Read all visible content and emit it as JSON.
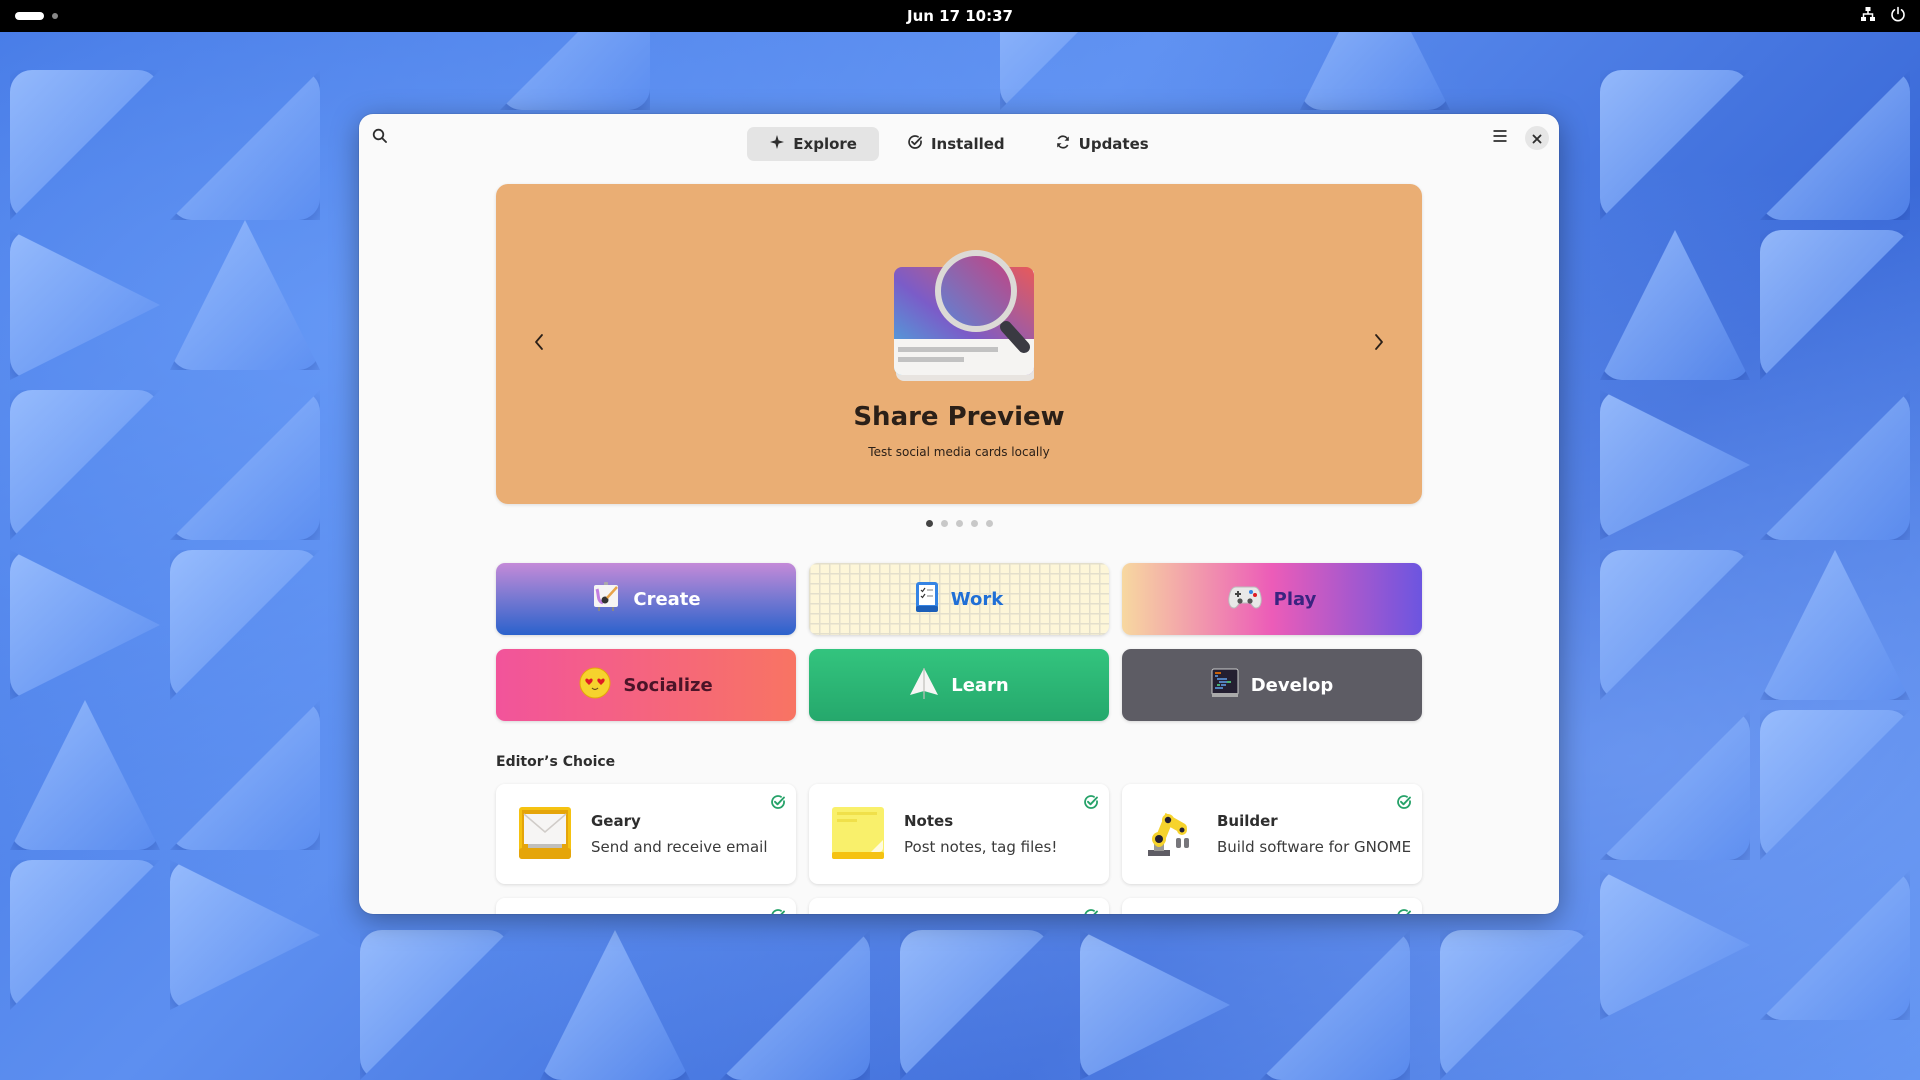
{
  "topbar": {
    "clock": "Jun 17  10:37",
    "workspace_indicator": "workspace-dots",
    "tray_icons": [
      "network-wired-icon",
      "power-icon"
    ]
  },
  "window": {
    "header": {
      "search_icon": "search-icon",
      "tabs": [
        {
          "label": "Explore",
          "icon": "explore-sparkle-icon",
          "active": true
        },
        {
          "label": "Installed",
          "icon": "check-circle-icon",
          "active": false
        },
        {
          "label": "Updates",
          "icon": "refresh-icon",
          "active": false
        }
      ],
      "menu_icon": "hamburger-menu-icon",
      "close_icon": "close-icon"
    },
    "carousel": {
      "title": "Share Preview",
      "subtitle": "Test social media cards locally",
      "background": "#eaae74",
      "page_count": 5,
      "current_page": 1
    },
    "categories": [
      {
        "label": "Create",
        "icon": "easel-paintbrush-icon"
      },
      {
        "label": "Work",
        "icon": "checklist-tray-icon"
      },
      {
        "label": "Play",
        "icon": "gamepad-icon"
      },
      {
        "label": "Socialize",
        "icon": "heart-eyes-emoji-icon"
      },
      {
        "label": "Learn",
        "icon": "paper-plane-icon"
      },
      {
        "label": "Develop",
        "icon": "code-terminal-icon"
      }
    ],
    "editors_choice": {
      "title": "Editor’s Choice",
      "apps": [
        {
          "name": "Geary",
          "description": "Send and receive email",
          "installed": true,
          "icon": "mail-tray-icon"
        },
        {
          "name": "Notes",
          "description": "Post notes, tag files!",
          "installed": true,
          "icon": "sticky-note-icon"
        },
        {
          "name": "Builder",
          "description": "Build software for GNOME",
          "installed": true,
          "icon": "robot-arm-icon"
        }
      ]
    },
    "colors": {
      "installed_check": "#26a269",
      "accent_work": "#1f6fd6"
    }
  }
}
